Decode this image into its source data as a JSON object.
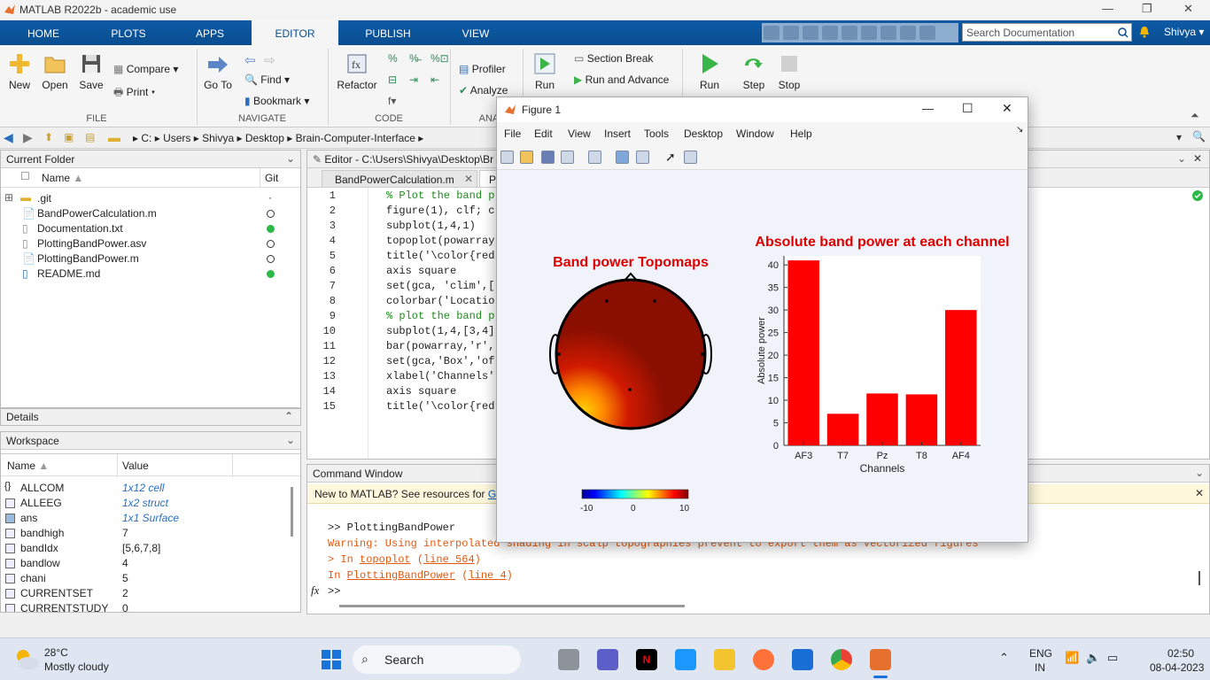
{
  "window": {
    "title": "MATLAB R2022b - academic use"
  },
  "tabs": [
    "HOME",
    "PLOTS",
    "APPS",
    "EDITOR",
    "PUBLISH",
    "VIEW"
  ],
  "active_tab": "EDITOR",
  "search": {
    "placeholder": "Search Documentation"
  },
  "user": "Shivya",
  "ribbon": {
    "file": {
      "new": "New",
      "open": "Open",
      "save": "Save",
      "compare": "Compare",
      "print": "Print",
      "section": "FILE"
    },
    "navigate": {
      "goto": "Go To",
      "find": "Find",
      "bookmark": "Bookmark",
      "section": "NAVIGATE"
    },
    "code": {
      "refactor": "Refactor",
      "section": "CODE"
    },
    "analyze": {
      "profiler": "Profiler",
      "analyze": "Analyze",
      "section": "ANAL"
    },
    "section": {
      "run": "Run",
      "section_break": "Section Break",
      "run_and_advance": "Run and Advance"
    },
    "run": {
      "run": "Run",
      "step": "Step",
      "stop": "Stop"
    }
  },
  "address": {
    "segments": [
      "C:",
      "Users",
      "Shivya",
      "Desktop",
      "Brain-Computer-Interface"
    ]
  },
  "current_folder": {
    "title": "Current Folder",
    "col_name": "Name",
    "col_git": "Git",
    "files": [
      {
        "name": ".git",
        "git": "·",
        "status": "none"
      },
      {
        "name": "BandPowerCalculation.m",
        "git": "",
        "status": "empty"
      },
      {
        "name": "Documentation.txt",
        "git": "",
        "status": "green"
      },
      {
        "name": "PlottingBandPower.asv",
        "git": "",
        "status": "empty"
      },
      {
        "name": "PlottingBandPower.m",
        "git": "",
        "status": "empty"
      },
      {
        "name": "README.md",
        "git": "",
        "status": "green"
      }
    ]
  },
  "details": {
    "title": "Details"
  },
  "workspace": {
    "title": "Workspace",
    "col_name": "Name",
    "col_value": "Value",
    "vars": [
      {
        "name": "ALLCOM",
        "value": "1x12 cell",
        "italic": true
      },
      {
        "name": "ALLEEG",
        "value": "1x2 struct",
        "italic": true
      },
      {
        "name": "ans",
        "value": "1x1 Surface",
        "italic": true
      },
      {
        "name": "bandhigh",
        "value": "7",
        "italic": false
      },
      {
        "name": "bandIdx",
        "value": "[5,6,7,8]",
        "italic": false
      },
      {
        "name": "bandlow",
        "value": "4",
        "italic": false
      },
      {
        "name": "chani",
        "value": "5",
        "italic": false
      },
      {
        "name": "CURRENTSET",
        "value": "2",
        "italic": false
      },
      {
        "name": "CURRENTSTUDY",
        "value": "0",
        "italic": false
      }
    ]
  },
  "editor": {
    "title": "Editor - C:\\Users\\Shivya\\Desktop\\Br",
    "tabs": [
      "BandPowerCalculation.m",
      "Pl"
    ],
    "lines": [
      "% Plot the band p",
      "figure(1), clf; c",
      "subplot(1,4,1)",
      "topoplot(powarray",
      "title('\\color{red",
      "axis square",
      "set(gca, 'clim',[",
      "colorbar('Locatio",
      "% plot the band p",
      "subplot(1,4,[3,4]",
      "bar(powarray,'r',",
      "set(gca,'Box','of",
      "xlabel('Channels'",
      "axis square",
      "title('\\color{red"
    ]
  },
  "command_window": {
    "title": "Command Window",
    "banner": "New to MATLAB? See resources for",
    "banner_link": "Get",
    "prompt_line": ">> PlottingBandPower",
    "warning": "Warning: Using interpolated shading in scalp topographies prevent to export them as vectorized figures",
    "in1_prefix": "> In",
    "in1_fn": "topoplot",
    "in1_line": "line 564",
    "in2_prefix": "In",
    "in2_fn": "PlottingBandPower",
    "in2_line": "line 4",
    "prompt": ">>",
    "fx": "fx"
  },
  "figure": {
    "title": "Figure 1",
    "menus": [
      "File",
      "Edit",
      "View",
      "Insert",
      "Tools",
      "Desktop",
      "Window",
      "Help"
    ],
    "topo_title": "Band power Topomaps",
    "colorbar_ticks": [
      "-10",
      "0",
      "10"
    ],
    "colors": {
      "title_red": "#e00000",
      "bar": "#ff0000"
    }
  },
  "chart_data": {
    "type": "bar",
    "title": "Absolute band power at each channel",
    "categories": [
      "AF3",
      "T7",
      "Pz",
      "T8",
      "AF4"
    ],
    "values": [
      41,
      7,
      11.5,
      11.3,
      30
    ],
    "xlabel": "Channels",
    "ylabel": "Absolute power",
    "ylim": [
      0,
      42
    ],
    "yticks": [
      0,
      5,
      10,
      15,
      20,
      25,
      30,
      35,
      40
    ],
    "color": "#ff0000"
  },
  "taskbar": {
    "weather_temp": "28°C",
    "weather_desc": "Mostly cloudy",
    "search": "Search",
    "lang1": "ENG",
    "lang2": "IN",
    "time": "02:50",
    "date": "08-04-2023"
  }
}
